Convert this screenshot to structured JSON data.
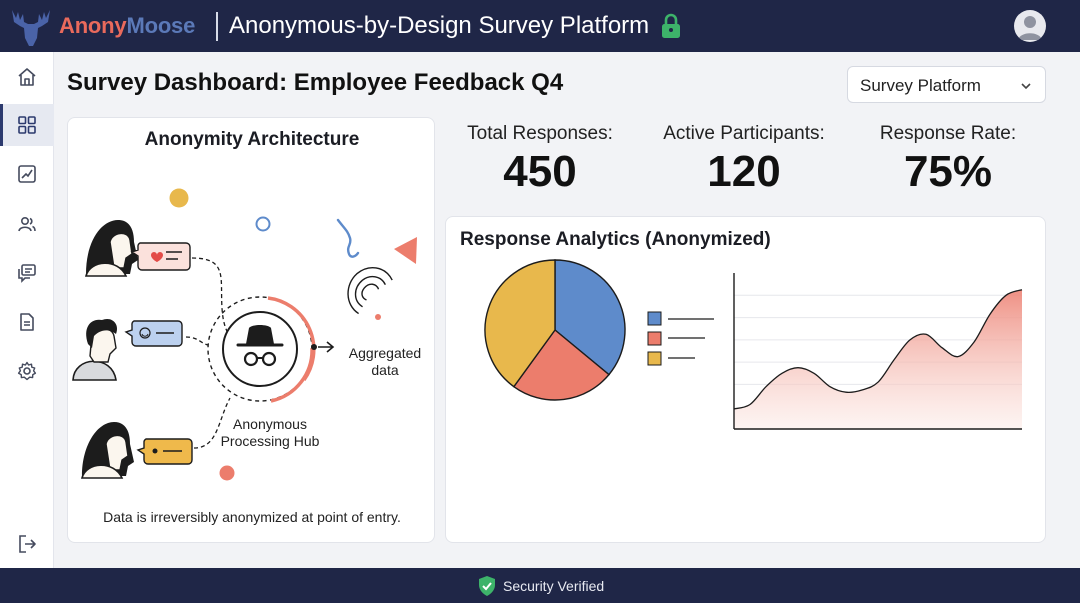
{
  "topbar": {
    "brand_part1": "Anony",
    "brand_part2": "Moose",
    "app_title": "Anonymous-by-Design Survey Platform",
    "lock_icon": "lock-icon",
    "avatar_icon": "user-avatar-icon"
  },
  "sidebar": {
    "items": [
      {
        "icon": "home-icon",
        "active": false
      },
      {
        "icon": "dashboard-grid-icon",
        "active": true
      },
      {
        "icon": "analytics-chart-icon",
        "active": false
      },
      {
        "icon": "users-icon",
        "active": false
      },
      {
        "icon": "feedback-messages-icon",
        "active": false
      },
      {
        "icon": "document-icon",
        "active": false
      },
      {
        "icon": "settings-gear-icon",
        "active": false
      }
    ],
    "logout_icon": "logout-icon"
  },
  "page": {
    "title": "Survey Dashboard: Employee Feedback Q4",
    "platform_select": "Survey Platform"
  },
  "architecture": {
    "title": "Anonymity Architecture",
    "hub_label": "Anonymous Processing Hub",
    "output_label": "Aggregated data",
    "caption": "Data is irreversibly anonymized at point of entry."
  },
  "stats": [
    {
      "label": "Total Responses:",
      "value": "450"
    },
    {
      "label": "Active Participants:",
      "value": "120"
    },
    {
      "label": "Response Rate:",
      "value": "75%"
    }
  ],
  "analytics": {
    "title": "Response Analytics (Anonymized)"
  },
  "chart_data": [
    {
      "type": "pie",
      "values": [
        36,
        24,
        40
      ],
      "colors": [
        "#5e8bcb",
        "#ec7d6c",
        "#e8b84c"
      ]
    },
    {
      "type": "area",
      "x": [
        0,
        1,
        2,
        3,
        4,
        5,
        6,
        7,
        8,
        9,
        10,
        11,
        12,
        13,
        14,
        15,
        16,
        17,
        18
      ],
      "y": [
        18,
        22,
        38,
        50,
        55,
        50,
        38,
        33,
        35,
        42,
        62,
        80,
        85,
        73,
        65,
        78,
        103,
        120,
        125
      ],
      "ylim": [
        0,
        140
      ],
      "grid": true,
      "color": "#e8776a"
    }
  ],
  "footer": {
    "status": "Security Verified",
    "shield_icon": "shield-check-icon"
  }
}
